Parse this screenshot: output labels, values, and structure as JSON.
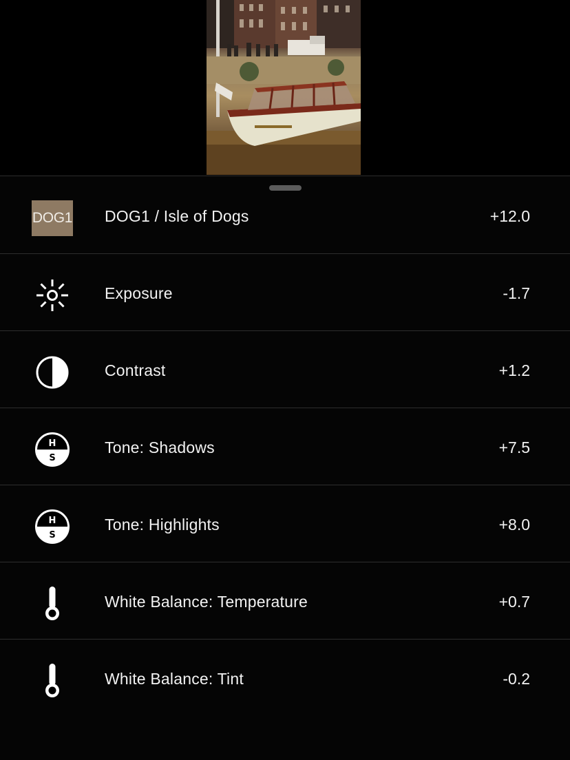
{
  "preview": {
    "image_icon": "photo-thumbnail"
  },
  "preset": {
    "chip_text": "DOG1",
    "chip_color": "#8e7a63",
    "label": "DOG1 / Isle of Dogs",
    "value": "+12.0"
  },
  "adjustments": [
    {
      "label": "Exposure",
      "value": "-1.7",
      "icon": "sun-icon"
    },
    {
      "label": "Contrast",
      "value": "+1.2",
      "icon": "contrast-icon"
    },
    {
      "label": "Tone: Shadows",
      "value": "+7.5",
      "icon": "tone-hs-icon",
      "icon_top": "H",
      "icon_bottom": "S"
    },
    {
      "label": "Tone: Highlights",
      "value": "+8.0",
      "icon": "tone-hs-icon",
      "icon_top": "H",
      "icon_bottom": "S"
    },
    {
      "label": "White Balance: Temperature",
      "value": "+0.7",
      "icon": "thermometer-icon"
    },
    {
      "label": "White Balance: Tint",
      "value": "-0.2",
      "icon": "thermometer-icon"
    }
  ]
}
